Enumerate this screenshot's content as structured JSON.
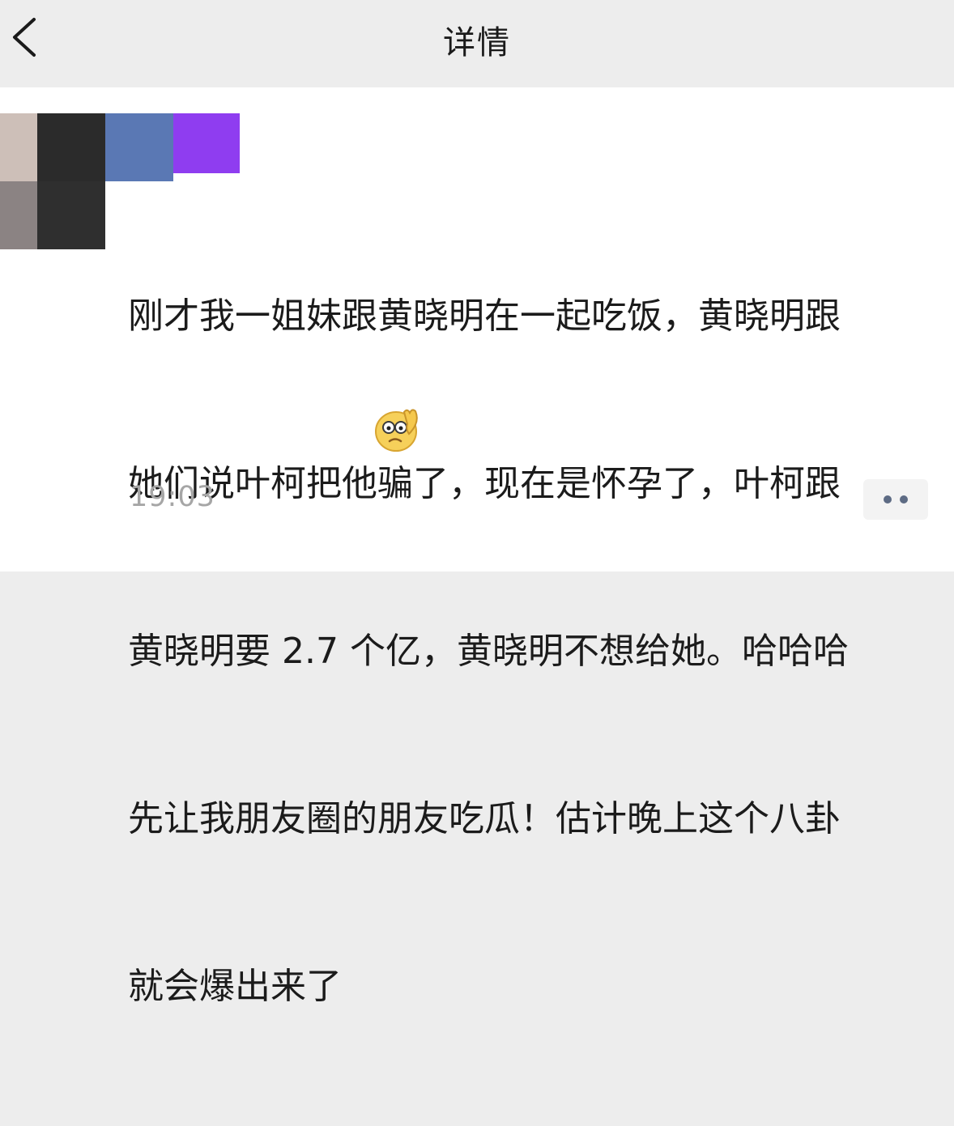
{
  "header": {
    "title": "详情",
    "back_icon": "chevron-left-icon"
  },
  "post": {
    "lines": [
      "刚才我一姐妹跟黄晓明在一起吃饭，黄晓明跟",
      "她们说叶柯把他骗了，现在是怀孕了，叶柯跟",
      "黄晓明要 2.7 个亿，黄晓明不想给她。哈哈哈",
      "先让我朋友圈的朋友吃瓜！估计晚上这个八卦",
      "就会爆出来了"
    ],
    "emoji": "facepalm-emoji",
    "timestamp": "19:03"
  },
  "actions": {
    "more_icon": "more-dots-icon"
  },
  "avatar": {
    "tile_colors": [
      "#cdbfb8",
      "#2b2b2b",
      "#5a78b4",
      "#8f3df0",
      "#8b8383",
      "#2f2f2f"
    ]
  }
}
